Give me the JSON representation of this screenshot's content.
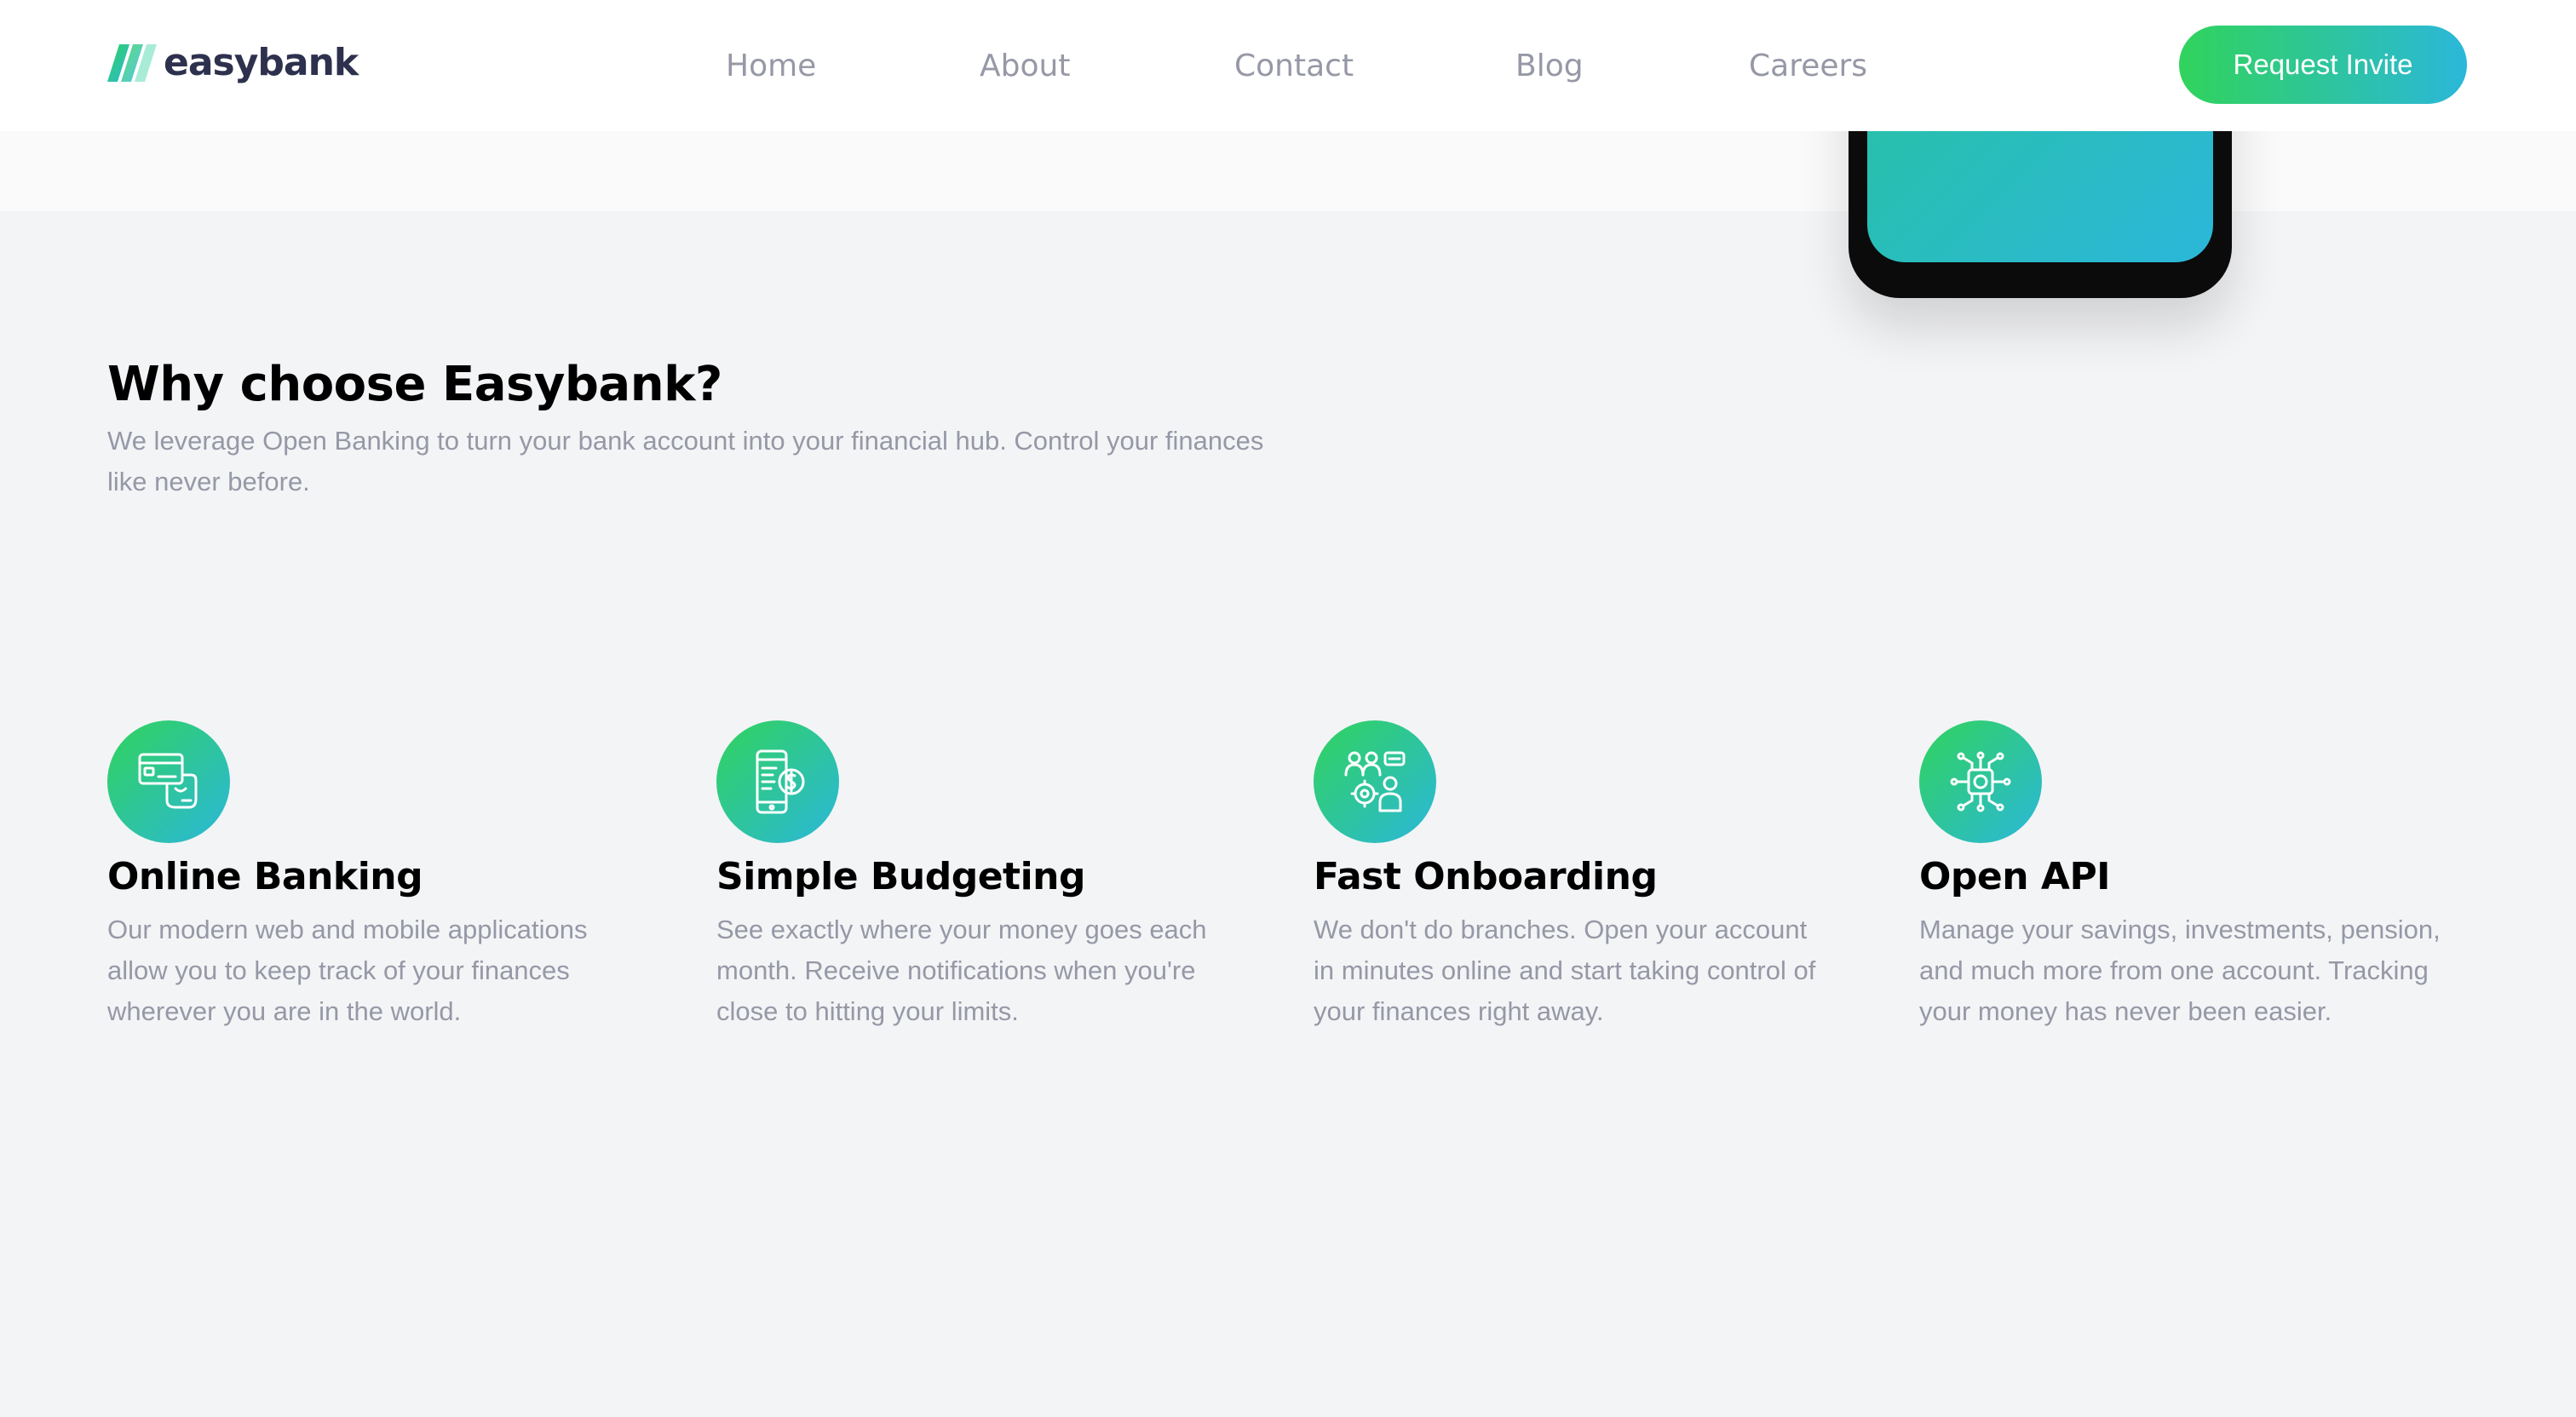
{
  "brand": {
    "name": "easybank",
    "colors": {
      "green": "#31d35c",
      "cyan": "#2bb7da",
      "navy": "#2d314d",
      "grayText": "#9698a6",
      "background": "#f3f4f6"
    }
  },
  "nav": {
    "items": [
      {
        "label": "Home"
      },
      {
        "label": "About"
      },
      {
        "label": "Contact"
      },
      {
        "label": "Blog"
      },
      {
        "label": "Careers"
      }
    ],
    "cta_label": "Request Invite"
  },
  "why": {
    "title": "Why choose Easybank?",
    "description": "We leverage Open Banking to turn your bank account into your financial hub. Control your finances like never before."
  },
  "features": [
    {
      "icon": "online-banking-icon",
      "title": "Online Banking",
      "description": "Our modern web and mobile applications allow you to keep track of your finances wherever you are in the world."
    },
    {
      "icon": "budgeting-icon",
      "title": "Simple Budgeting",
      "description": "See exactly where your money goes each month. Receive notifications when you're close to hitting your limits."
    },
    {
      "icon": "onboarding-icon",
      "title": "Fast Onboarding",
      "description": "We don't do branches. Open your account in minutes online and start taking control of your finances right away."
    },
    {
      "icon": "api-icon",
      "title": "Open API",
      "description": "Manage your savings, investments, pension, and much more from one account. Tracking your money has never been easier."
    }
  ]
}
